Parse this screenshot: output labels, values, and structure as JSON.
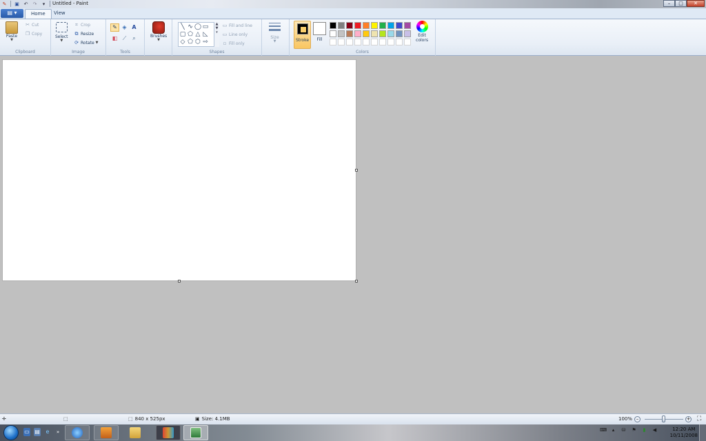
{
  "window": {
    "title": "Untitled - Paint",
    "controls": [
      "minimize",
      "maximize",
      "close"
    ]
  },
  "quick_access": {
    "icons": [
      "paint-icon",
      "save-icon",
      "undo-icon",
      "redo-icon",
      "customize-icon"
    ]
  },
  "ribbon": {
    "tabs": [
      "Home",
      "View"
    ],
    "active_tab": "Home",
    "clipboard": {
      "paste": "Paste",
      "cut": "Cut",
      "copy": "Copy",
      "label": "Clipboard"
    },
    "image": {
      "select": "Select",
      "crop": "Crop",
      "resize": "Resize",
      "rotate": "Rotate",
      "label": "Image"
    },
    "tools": {
      "label": "Tools"
    },
    "brushes": {
      "label": "Brushes"
    },
    "shapes": {
      "fill_and_line": "Fill and line",
      "line_only": "Line only",
      "fill_only": "Fill only",
      "label": "Shapes"
    },
    "size": {
      "label": "Size"
    },
    "colors": {
      "stroke": "Stroke",
      "fill": "Fill",
      "edit_colors": "Edit colors",
      "label": "Colors",
      "stroke_color": "#000000",
      "fill_color": "#ffffff",
      "palette": [
        "#000000",
        "#7f7f7f",
        "#880015",
        "#ed1c24",
        "#ff7f27",
        "#fff200",
        "#22b14c",
        "#00a2e8",
        "#3f48cc",
        "#a349a4",
        "#ffffff",
        "#c3c3c3",
        "#b97a57",
        "#ffaec9",
        "#ffc90e",
        "#efe4b0",
        "#b5e61d",
        "#99d9ea",
        "#7092be",
        "#c8bfe7",
        "#ffffff",
        "#ffffff",
        "#ffffff",
        "#ffffff",
        "#ffffff",
        "#ffffff",
        "#ffffff",
        "#ffffff",
        "#ffffff",
        "#ffffff"
      ]
    }
  },
  "status": {
    "dimensions": "840 x 525px",
    "size": "Size: 4.1MB",
    "zoom": "100%",
    "zoom_level_fraction": 0.5
  },
  "taskbar": {
    "clock_time": "12:20 AM",
    "clock_date": "10/11/2008"
  }
}
